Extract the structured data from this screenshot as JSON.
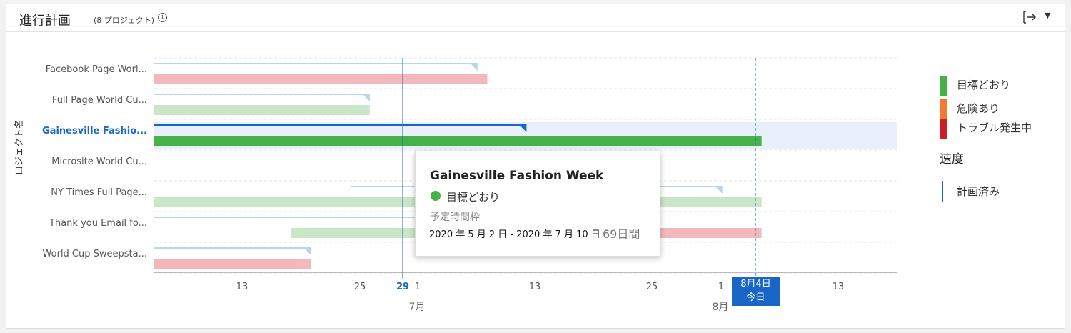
{
  "header": {
    "title": "進行計画",
    "subtitle": "(8 プロジェクト)",
    "info_glyph": "i",
    "info_icon": "info-icon",
    "export_icon": "export-arrow-icon",
    "menu_icon": "caret-down-icon",
    "menu_glyph": "▼"
  },
  "chart_data": {
    "type": "gantt",
    "ylabel": "ロジェクト名",
    "x_ticks": [
      "13",
      "25",
      "29",
      "1",
      "13",
      "25",
      "1",
      "13"
    ],
    "current_tick": "29",
    "months": [
      "7月",
      "8月"
    ],
    "today": {
      "date": "8月4日",
      "label": "今日"
    },
    "rows": [
      {
        "name": "Facebook Page Worl...",
        "planned": [
          "2020-06-02",
          "2020-07-05"
        ],
        "actual": [
          "2020-06-02",
          "2020-07-06"
        ],
        "status": [
          "trouble"
        ]
      },
      {
        "name": "Full Page World Cu...",
        "planned": [
          "2020-06-02",
          "2020-06-24"
        ],
        "actual": [
          "2020-06-02",
          "2020-06-24"
        ],
        "status": [
          "on_track"
        ]
      },
      {
        "name": "Gainesville Fashio...",
        "planned": [
          "2020-06-02",
          "2020-07-10"
        ],
        "actual": [
          "2020-06-02",
          "2020-08-03"
        ],
        "status": [
          "on_track"
        ],
        "highlighted": true
      },
      {
        "name": "Microsite World Cu...",
        "planned": null,
        "actual": null,
        "status": []
      },
      {
        "name": "NY Times Full Page...",
        "planned": [
          "2020-06-22",
          "2020-07-30"
        ],
        "actual": [
          "2020-06-02",
          "2020-08-03"
        ],
        "status": [
          "on_track"
        ]
      },
      {
        "name": "Thank you Email fo...",
        "planned": [
          "2020-06-02",
          "2020-07-15"
        ],
        "actual": [
          "2020-06-16",
          "2020-08-03"
        ],
        "status": [
          "on_track",
          "at_risk",
          "trouble"
        ]
      },
      {
        "name": "World Cup Sweepsta...",
        "planned": [
          "2020-06-02",
          "2020-06-18"
        ],
        "actual": [
          "2020-06-02",
          "2020-06-18"
        ],
        "status": [
          "trouble"
        ]
      }
    ],
    "legend": [
      {
        "key": "on_track",
        "label": "目標どおり",
        "color": "#46b146",
        "light": "#c9e6c6"
      },
      {
        "key": "at_risk",
        "label": "危険あり",
        "color": "#f07c33",
        "light": "#fbd9c1"
      },
      {
        "key": "trouble",
        "label": "トラブル発生中",
        "color": "#cc1f25",
        "light": "#f2b8bb"
      }
    ],
    "velocity_heading": "速度",
    "planned_label": "計画済み",
    "planned_color": "#b9d3f1"
  },
  "tooltip": {
    "title": "Gainesville Fashion Week",
    "status": "目標どおり",
    "label": "予定時間枠",
    "range": "2020 年 5 月 2 日 - 2020 年 7 月 10 日",
    "duration": "69日間"
  }
}
